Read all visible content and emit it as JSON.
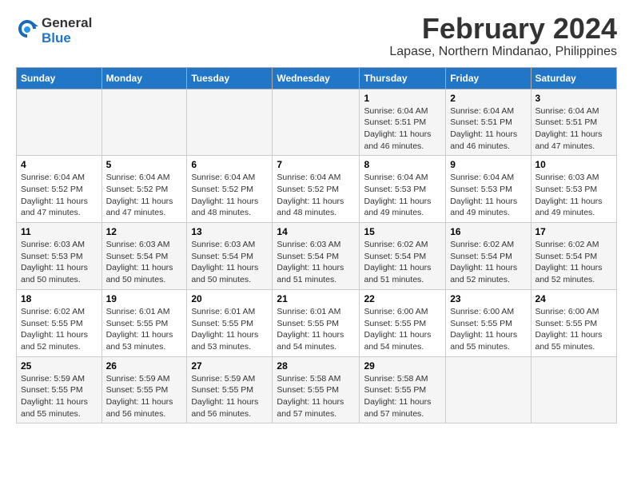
{
  "header": {
    "logo_line1": "General",
    "logo_line2": "Blue",
    "title": "February 2024",
    "subtitle": "Lapase, Northern Mindanao, Philippines"
  },
  "columns": [
    "Sunday",
    "Monday",
    "Tuesday",
    "Wednesday",
    "Thursday",
    "Friday",
    "Saturday"
  ],
  "weeks": [
    [
      {
        "day": "",
        "info": ""
      },
      {
        "day": "",
        "info": ""
      },
      {
        "day": "",
        "info": ""
      },
      {
        "day": "",
        "info": ""
      },
      {
        "day": "1",
        "info": "Sunrise: 6:04 AM\nSunset: 5:51 PM\nDaylight: 11 hours\nand 46 minutes."
      },
      {
        "day": "2",
        "info": "Sunrise: 6:04 AM\nSunset: 5:51 PM\nDaylight: 11 hours\nand 46 minutes."
      },
      {
        "day": "3",
        "info": "Sunrise: 6:04 AM\nSunset: 5:51 PM\nDaylight: 11 hours\nand 47 minutes."
      }
    ],
    [
      {
        "day": "4",
        "info": "Sunrise: 6:04 AM\nSunset: 5:52 PM\nDaylight: 11 hours\nand 47 minutes."
      },
      {
        "day": "5",
        "info": "Sunrise: 6:04 AM\nSunset: 5:52 PM\nDaylight: 11 hours\nand 47 minutes."
      },
      {
        "day": "6",
        "info": "Sunrise: 6:04 AM\nSunset: 5:52 PM\nDaylight: 11 hours\nand 48 minutes."
      },
      {
        "day": "7",
        "info": "Sunrise: 6:04 AM\nSunset: 5:52 PM\nDaylight: 11 hours\nand 48 minutes."
      },
      {
        "day": "8",
        "info": "Sunrise: 6:04 AM\nSunset: 5:53 PM\nDaylight: 11 hours\nand 49 minutes."
      },
      {
        "day": "9",
        "info": "Sunrise: 6:04 AM\nSunset: 5:53 PM\nDaylight: 11 hours\nand 49 minutes."
      },
      {
        "day": "10",
        "info": "Sunrise: 6:03 AM\nSunset: 5:53 PM\nDaylight: 11 hours\nand 49 minutes."
      }
    ],
    [
      {
        "day": "11",
        "info": "Sunrise: 6:03 AM\nSunset: 5:53 PM\nDaylight: 11 hours\nand 50 minutes."
      },
      {
        "day": "12",
        "info": "Sunrise: 6:03 AM\nSunset: 5:54 PM\nDaylight: 11 hours\nand 50 minutes."
      },
      {
        "day": "13",
        "info": "Sunrise: 6:03 AM\nSunset: 5:54 PM\nDaylight: 11 hours\nand 50 minutes."
      },
      {
        "day": "14",
        "info": "Sunrise: 6:03 AM\nSunset: 5:54 PM\nDaylight: 11 hours\nand 51 minutes."
      },
      {
        "day": "15",
        "info": "Sunrise: 6:02 AM\nSunset: 5:54 PM\nDaylight: 11 hours\nand 51 minutes."
      },
      {
        "day": "16",
        "info": "Sunrise: 6:02 AM\nSunset: 5:54 PM\nDaylight: 11 hours\nand 52 minutes."
      },
      {
        "day": "17",
        "info": "Sunrise: 6:02 AM\nSunset: 5:54 PM\nDaylight: 11 hours\nand 52 minutes."
      }
    ],
    [
      {
        "day": "18",
        "info": "Sunrise: 6:02 AM\nSunset: 5:55 PM\nDaylight: 11 hours\nand 52 minutes."
      },
      {
        "day": "19",
        "info": "Sunrise: 6:01 AM\nSunset: 5:55 PM\nDaylight: 11 hours\nand 53 minutes."
      },
      {
        "day": "20",
        "info": "Sunrise: 6:01 AM\nSunset: 5:55 PM\nDaylight: 11 hours\nand 53 minutes."
      },
      {
        "day": "21",
        "info": "Sunrise: 6:01 AM\nSunset: 5:55 PM\nDaylight: 11 hours\nand 54 minutes."
      },
      {
        "day": "22",
        "info": "Sunrise: 6:00 AM\nSunset: 5:55 PM\nDaylight: 11 hours\nand 54 minutes."
      },
      {
        "day": "23",
        "info": "Sunrise: 6:00 AM\nSunset: 5:55 PM\nDaylight: 11 hours\nand 55 minutes."
      },
      {
        "day": "24",
        "info": "Sunrise: 6:00 AM\nSunset: 5:55 PM\nDaylight: 11 hours\nand 55 minutes."
      }
    ],
    [
      {
        "day": "25",
        "info": "Sunrise: 5:59 AM\nSunset: 5:55 PM\nDaylight: 11 hours\nand 55 minutes."
      },
      {
        "day": "26",
        "info": "Sunrise: 5:59 AM\nSunset: 5:55 PM\nDaylight: 11 hours\nand 56 minutes."
      },
      {
        "day": "27",
        "info": "Sunrise: 5:59 AM\nSunset: 5:55 PM\nDaylight: 11 hours\nand 56 minutes."
      },
      {
        "day": "28",
        "info": "Sunrise: 5:58 AM\nSunset: 5:55 PM\nDaylight: 11 hours\nand 57 minutes."
      },
      {
        "day": "29",
        "info": "Sunrise: 5:58 AM\nSunset: 5:55 PM\nDaylight: 11 hours\nand 57 minutes."
      },
      {
        "day": "",
        "info": ""
      },
      {
        "day": "",
        "info": ""
      }
    ]
  ]
}
